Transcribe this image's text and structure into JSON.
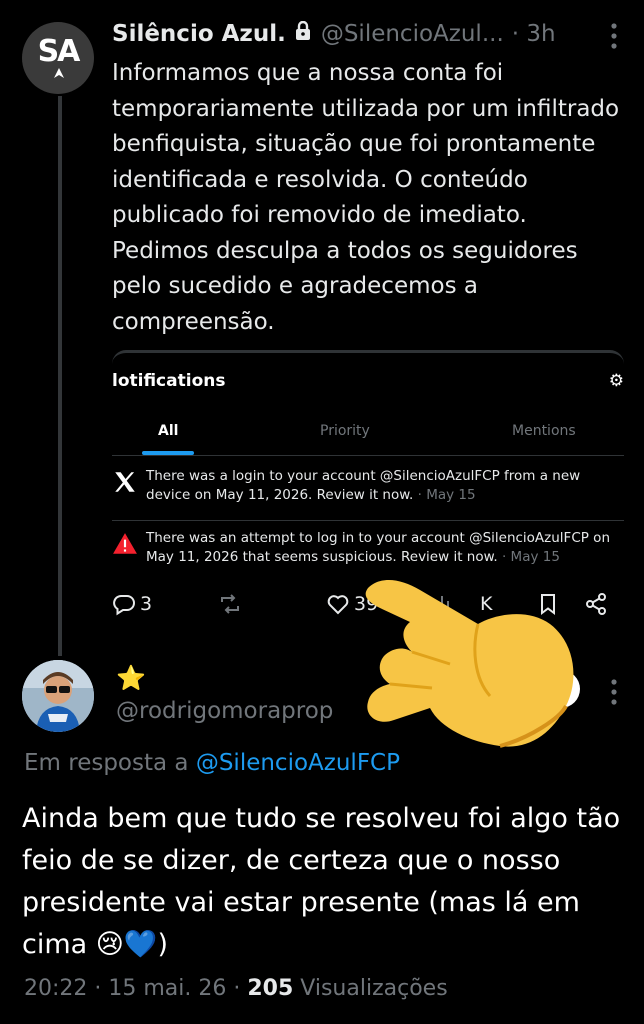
{
  "tweet": {
    "author_name": "Silêncio Azul.",
    "author_handle": "@SilencioAzul...",
    "time": "· 3h",
    "avatar_text": "SA",
    "text": "Informamos que a nossa conta foi temporariamente utilizada por um infiltrado benfiquista, situação que foi prontamente identificada e resolvida. O conteúdo publicado foi removido de imediato. Pedimos desculpa a todos os seguidores pelo sucedido e agradecemos a compreensão.",
    "card": {
      "title": "lotifications",
      "tabs": [
        "All",
        "Priority",
        "Mentions"
      ],
      "notifications": [
        {
          "icon": "x-logo-icon",
          "text": "There was a login to your account @SilencioAzulFCP from a new device on May 11, 2026. Review it now.",
          "date": " · May 15"
        },
        {
          "icon": "warning-icon",
          "text": "There was an attempt to log in to your account @SilencioAzulFCP on May 11, 2026 that seems suspicious. Review it now.",
          "date": " · May 15"
        }
      ]
    },
    "actions": {
      "replies": "3",
      "likes": "39",
      "views": "K"
    }
  },
  "reply": {
    "emoji": "⭐",
    "handle": "@rodrigomoraprop",
    "reply_prefix": "Em resposta a ",
    "reply_mention": "@SilencioAzulFCP",
    "text": "Ainda bem que tudo se resolveu foi algo tão feio de se dizer, de certeza que o nosso presidente vai estar presente (mas lá em cima 😢💙)",
    "time": "20:22 · 15 mai. 26 · ",
    "views_count": "205",
    "views_label": " Visualizações"
  },
  "colors": {
    "accent": "#1d9bf0",
    "background": "#000000",
    "muted": "#71767b",
    "warning": "#f4212e"
  }
}
